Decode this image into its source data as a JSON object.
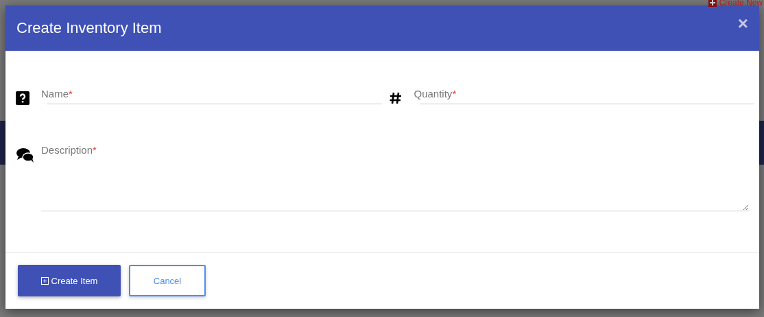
{
  "background": {
    "link": "Create New"
  },
  "dialog": {
    "title": "Create Inventory Item",
    "close": "×"
  },
  "fields": [
    {
      "kind": "text",
      "label": "Name",
      "required_mark": "*"
    },
    {
      "kind": "number",
      "label": "Quantity",
      "required_mark": "*"
    },
    {
      "kind": "textarea",
      "label": "Description",
      "required_mark": "*"
    }
  ],
  "buttons": [
    {
      "kind": "primary",
      "label": "Create Item"
    },
    {
      "kind": "secondary",
      "label": "Cancel"
    }
  ]
}
